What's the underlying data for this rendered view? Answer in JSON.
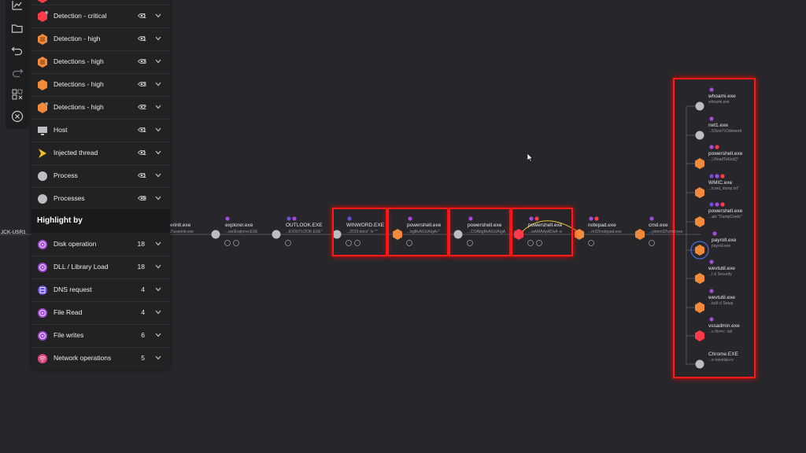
{
  "toolbar": {
    "buttons": [
      "chart-icon",
      "folder-icon",
      "undo-icon",
      "redo-icon",
      "select-icon",
      "close-circle-icon"
    ]
  },
  "panel": {
    "rows": [
      {
        "label": "Detection - critical",
        "count": "1",
        "icon": "red-hexagon-icon"
      },
      {
        "label": "Detection - high",
        "count": "1",
        "icon": "orange-hexagon-icon"
      },
      {
        "label": "Detections - high",
        "count": "3",
        "icon": "orange-hexagon-icon"
      },
      {
        "label": "Detections - high",
        "count": "3",
        "icon": "orange-hexagon-icon"
      },
      {
        "label": "Detections - high",
        "count": "2",
        "icon": "orange-hexagon-icon"
      },
      {
        "label": "Host",
        "count": "1",
        "icon": "monitor-icon"
      },
      {
        "label": "Injected thread",
        "count": "1",
        "icon": "arrow-icon"
      },
      {
        "label": "Process",
        "count": "1",
        "icon": "grey-circle-icon"
      },
      {
        "label": "Processes",
        "count": "9",
        "icon": "grey-circle-icon"
      }
    ],
    "highlight_title": "Highlight by",
    "highlight_rows": [
      {
        "label": "Disk operation",
        "count": "18",
        "icon": "disk-icon"
      },
      {
        "label": "DLL / Library Load",
        "count": "18",
        "icon": "dll-icon"
      },
      {
        "label": "DNS request",
        "count": "4",
        "icon": "dns-icon"
      },
      {
        "label": "File Read",
        "count": "4",
        "icon": "file-read-icon"
      },
      {
        "label": "File writes",
        "count": "6",
        "icon": "file-write-icon"
      },
      {
        "label": "Network operations",
        "count": "5",
        "icon": "network-icon"
      }
    ]
  },
  "graph": {
    "host_label": "JCK-USR1",
    "chain": [
      {
        "name": "erinit.exe",
        "sub": "Z\\userinit.exe"
      },
      {
        "name": "explorer.exe",
        "sub": "...ws\\Explorer.EXE"
      },
      {
        "name": "OUTLOOK.EXE",
        "sub": "...E\\OUTLOOK.EXE\""
      },
      {
        "name": "WINWORD.EXE",
        "sub": "...2019.docx\" /o \"\""
      },
      {
        "name": "powershell.exe",
        "sub": "...bgBvAGUAIgA+\""
      },
      {
        "name": "powershell.exe",
        "sub": "...COAbgBvAGUAIgA"
      },
      {
        "name": "powershell.exe",
        "sub": "...wAMAApADsA -e"
      },
      {
        "name": "notepad.exe",
        "sub": "...m32\\notepad.exe"
      },
      {
        "name": "cmd.exe",
        "sub": "...ystem32\\cmd.exe"
      }
    ],
    "children": [
      {
        "name": "whoami.exe",
        "sub": "whoami.exe"
      },
      {
        "name": "net1.exe",
        "sub": "...53cre7cOdeword"
      },
      {
        "name": "powershell.exe",
        "sub": "...).ReadToEnd()\""
      },
      {
        "name": "WMIC.exe",
        "sub": "...lcred_dump.txt\""
      },
      {
        "name": "powershell.exe",
        "sub": "...atz \"DumpCreds\""
      },
      {
        "name": "payroll.exe",
        "sub": "payroll.exe"
      },
      {
        "name": "wevtutil.exe",
        "sub": "...l  cl Security"
      },
      {
        "name": "wevtutil.exe",
        "sub": "...tutil  cl Setup"
      },
      {
        "name": "vssadmin.exe",
        "sub": "...s /for=c: /all"
      },
      {
        "name": "Chrome.EXE",
        "sub": "...e  travelair.ru"
      }
    ]
  },
  "colors": {
    "background": "#27272b",
    "panel": "#222225",
    "highlight_red": "#ff1a1a",
    "orange": "#f28a3a",
    "critical_red": "#ff3b4a",
    "purple": "#a24bdb",
    "grey_node": "#bdbdc2"
  }
}
